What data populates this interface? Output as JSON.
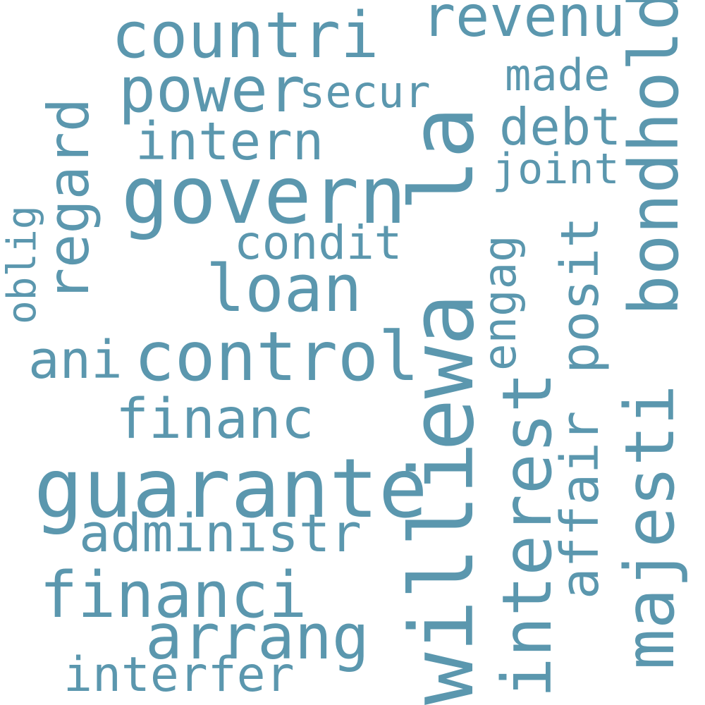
{
  "color": "#5b97ae",
  "words": {
    "willi": "willi",
    "ewa": "ewa",
    "la": "la",
    "guarante": "guarante",
    "govern": "govern",
    "countri": "countri",
    "control": "control",
    "interest": "interest",
    "bondhold": "bondhold",
    "majesti": "majesti",
    "financi": "financi",
    "loan": "loan",
    "arrang": "arrang",
    "power": "power",
    "financ": "financ",
    "intern": "intern",
    "revenu": "revenu",
    "regard": "regard",
    "posit": "posit",
    "affair": "affair",
    "administr": "administr",
    "debt": "debt",
    "ani": "ani",
    "made": "made",
    "interfer": "interfer",
    "condit": "condit",
    "secur": "secur",
    "joint": "joint",
    "engag": "engag",
    "oblig": "oblig"
  }
}
